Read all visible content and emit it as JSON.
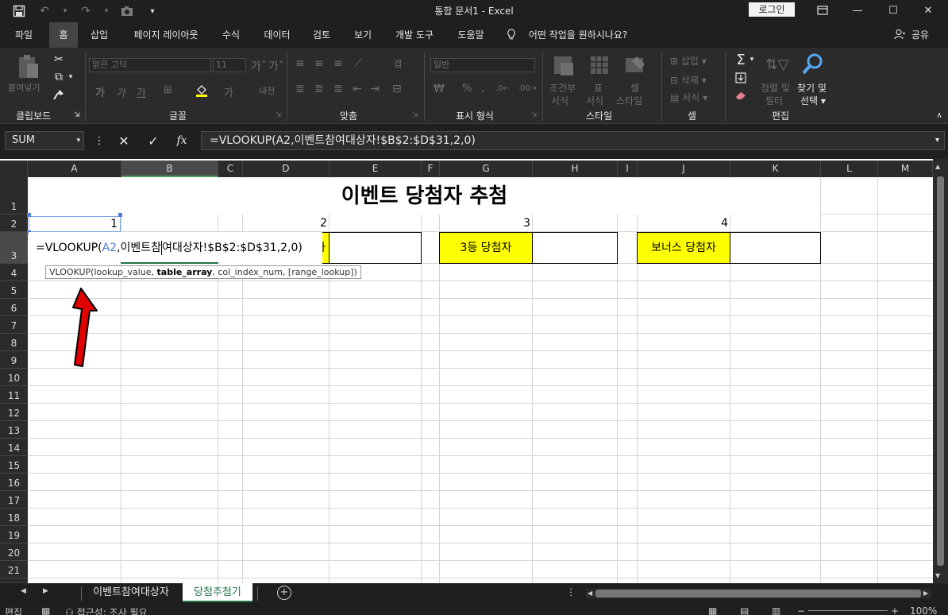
{
  "window": {
    "title": "통합 문서1  -  Excel",
    "login_label": "로그인"
  },
  "menu": {
    "tabs": [
      "파일",
      "홈",
      "삽입",
      "페이지 레이아웃",
      "수식",
      "데이터",
      "검토",
      "보기",
      "개발 도구",
      "도움말"
    ],
    "active_tab": "홈",
    "tell_me": "어떤 작업을 원하시나요?",
    "share": "공유"
  },
  "ribbon": {
    "groups": [
      "클립보드",
      "글꼴",
      "맞춤",
      "표시 형식",
      "스타일",
      "셀",
      "편집"
    ],
    "paste_label": "붙여넣기",
    "font_name": "맑은 고딕",
    "font_size": "11",
    "number_format": "일반",
    "conditional_format_1": "조건부",
    "conditional_format_2": "서식",
    "table_format_1": "표",
    "table_format_2": "서식",
    "cell_style_1": "셀",
    "cell_style_2": "스타일",
    "insert_label": "삽입",
    "delete_label": "삭제",
    "format_label": "서식",
    "sort_filter_1": "정렬 및",
    "sort_filter_2": "필터",
    "find_select_1": "찾기 및",
    "find_select_2": "선택"
  },
  "formula_bar": {
    "name_box": "SUM",
    "formula": "=VLOOKUP(A2,이벤트참여대상자!$B$2:$D$31,2,0)"
  },
  "grid": {
    "columns": [
      "A",
      "B",
      "C",
      "D",
      "E",
      "F",
      "G",
      "H",
      "I",
      "J",
      "K",
      "L",
      "M"
    ],
    "selected_column": "B",
    "rows": [
      "1",
      "2",
      "3",
      "4",
      "5",
      "6",
      "7",
      "8",
      "9",
      "10",
      "11",
      "12",
      "13",
      "14",
      "15",
      "16",
      "17",
      "18",
      "19",
      "20",
      "21"
    ],
    "selected_row": "3",
    "title": "이벤트 당첨자 추첨",
    "row2_numbers": [
      "1",
      "2",
      "3",
      "4"
    ],
    "labels": {
      "first_partial": "자",
      "third": "3등 당첨자",
      "bonus": "보너스 당첨자"
    },
    "edit": {
      "prefix": "=VLOOKUP(",
      "ref": "A2",
      "part1": ",이벤트참",
      "part2": "여대상자!$B$2:$D$31,2,0)"
    },
    "tooltip": {
      "func": "VLOOKUP(lookup_value, ",
      "bold_arg": "table_array",
      "rest": ", col_index_num, [range_lookup])"
    }
  },
  "sheets": {
    "tabs": [
      "이벤트참여대상자",
      "당첨추첨기"
    ],
    "active": "당첨추첨기"
  },
  "status": {
    "mode": "편집",
    "accessibility": "접근성: 조사 필요",
    "zoom": "100%"
  },
  "colors": {
    "highlight": "#ffff00",
    "excel_green": "#217346",
    "annotation_arrow": "#e00000"
  }
}
